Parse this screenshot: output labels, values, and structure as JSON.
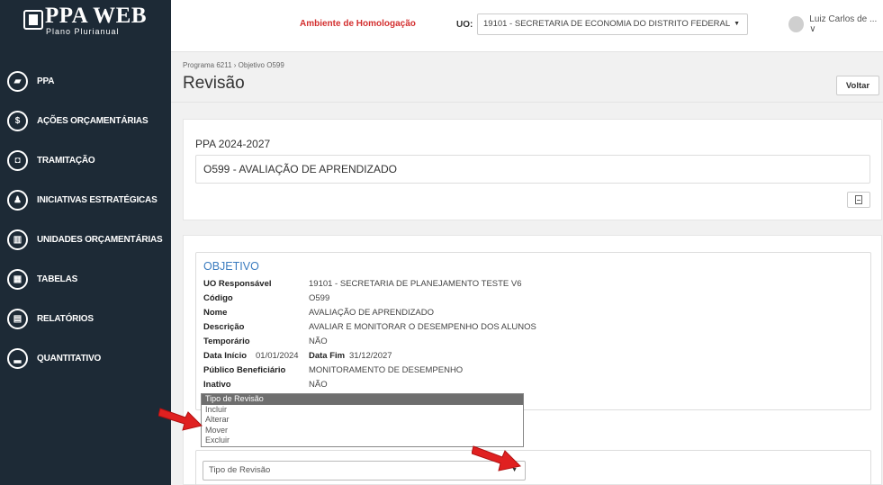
{
  "app": {
    "logo_title": "PPA WEB",
    "logo_subtitle": "Plano Plurianual"
  },
  "sidebar": {
    "items": [
      {
        "label": "PPA",
        "icon": "book-icon",
        "glyph": "▰"
      },
      {
        "label": "AÇÕES ORÇAMENTÁRIAS",
        "icon": "dollar-icon",
        "glyph": "$"
      },
      {
        "label": "TRAMITAÇÃO",
        "icon": "inbox-icon",
        "glyph": "◘"
      },
      {
        "label": "INICIATIVAS ESTRATÉGICAS",
        "icon": "users-icon",
        "glyph": "♟"
      },
      {
        "label": "UNIDADES ORÇAMENTÁRIAS",
        "icon": "bank-icon",
        "glyph": "▥"
      },
      {
        "label": "TABELAS",
        "icon": "table-icon",
        "glyph": "▦"
      },
      {
        "label": "RELATÓRIOS",
        "icon": "report-icon",
        "glyph": "▤"
      },
      {
        "label": "QUANTITATIVO",
        "icon": "chart-icon",
        "glyph": "▂"
      }
    ]
  },
  "topbar": {
    "environment": "Ambiente de Homologação",
    "uo_label": "UO:",
    "uo_value": "19101 - SECRETARIA DE ECONOMIA DO DISTRITO FEDERAL",
    "user_name": "Luiz Carlos de ... ∨"
  },
  "page": {
    "breadcrumb": "Programa 6211 › Objetivo O599",
    "title": "Revisão",
    "back_label": "Voltar"
  },
  "ppa_card": {
    "ppa": "PPA 2024-2027",
    "objective": "O599 - AVALIAÇÃO DE APRENDIZADO"
  },
  "objetivo": {
    "title": "OBJETIVO",
    "uo_k": "UO Responsável",
    "uo_v": "19101 - SECRETARIA DE PLANEJAMENTO TESTE V6",
    "codigo_k": "Código",
    "codigo_v": "O599",
    "nome_k": "Nome",
    "nome_v": "AVALIAÇÃO DE APRENDIZADO",
    "desc_k": "Descrição",
    "desc_v": "AVALIAR E MONITORAR O DESEMPENHO DOS ALUNOS",
    "temp_k": "Temporário",
    "temp_v": "NÃO",
    "inicio_k": "Data Início",
    "inicio_v": "01/01/2024",
    "fim_k": "Data Fim",
    "fim_v": "31/12/2027",
    "pub_k": "Público Beneficiário",
    "pub_v": "MONITORAMENTO DE DESEMPENHO",
    "inativo_k": "Inativo",
    "inativo_v": "NÃO"
  },
  "revisao": {
    "select_value": "Tipo de Revisão",
    "options": [
      "Tipo de Revisão",
      "Incluir",
      "Alterar",
      "Mover",
      "Excluir"
    ]
  },
  "colors": {
    "sidebar_bg": "#1d2a36",
    "environment": "#d32f2f",
    "objetivo_title": "#3a7bbf",
    "arrow": "#e02020"
  }
}
